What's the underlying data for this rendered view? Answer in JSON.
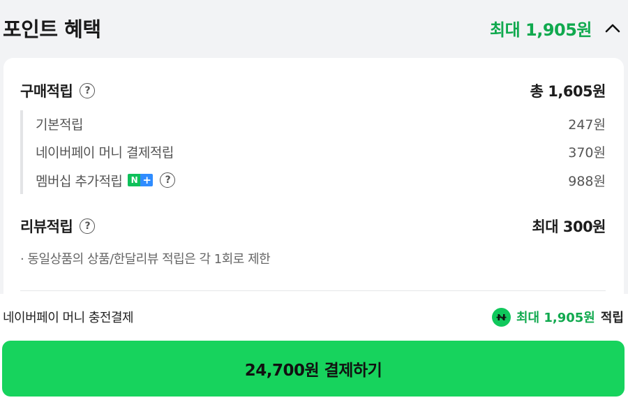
{
  "header": {
    "title": "포인트 혜택",
    "max_points": "최대 1,905원",
    "toggle_icon": "chevron-up-icon"
  },
  "purchase": {
    "title": "구매적립",
    "help_icon": "question-circle-icon",
    "total": "총 1,605원",
    "items": [
      {
        "label": "기본적립",
        "value": "247원"
      },
      {
        "label": "네이버페이 머니 결제적립",
        "value": "370원"
      },
      {
        "label": "멤버십 추가적립",
        "value": "988원",
        "badge_n": "N",
        "badge_plus": "+"
      }
    ]
  },
  "review": {
    "title": "리뷰적립",
    "value": "최대 300원",
    "note": "· 동일상품의 상품/한달리뷰 적립은 각 1회로 제한"
  },
  "payment": {
    "method_label": "네이버페이 머니 충전결제",
    "icon": "naver-pay-icon",
    "max_points": "최대 1,905원",
    "max_suffix": "적립",
    "button_label": "24,700원 결제하기"
  },
  "colors": {
    "accent_green": "#10a94e",
    "button_green": "#17d35d",
    "badge_green": "#0ec05a",
    "badge_blue": "#2f8cff"
  }
}
